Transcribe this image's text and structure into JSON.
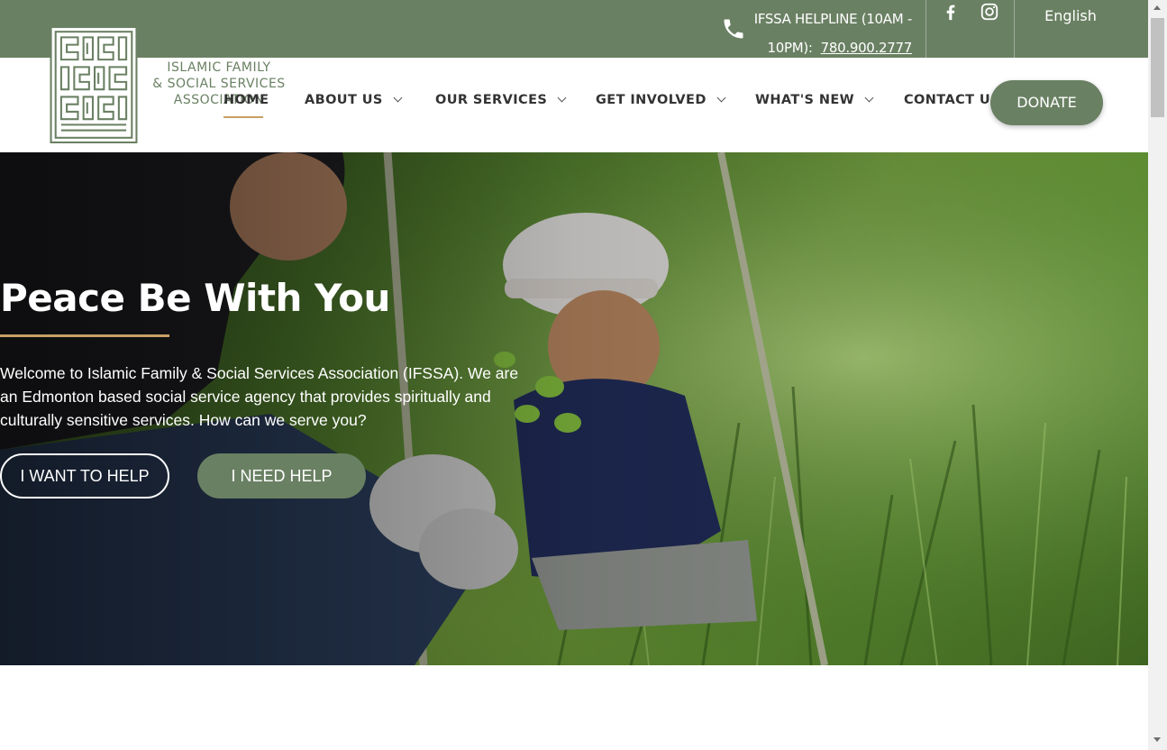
{
  "topbar": {
    "helpline_label": "IFSSA HELPLINE (10AM - 10PM):",
    "helpline_phone": "780.900.2777",
    "language": "English",
    "icons": [
      "phone-icon",
      "facebook-icon",
      "instagram-icon"
    ]
  },
  "logo": {
    "line1": "ISLAMIC FAMILY",
    "line2": "& SOCIAL SERVICES",
    "line3": "ASSOCIATION"
  },
  "nav": {
    "home": "HOME",
    "about": "ABOUT US",
    "services": "OUR SERVICES",
    "involved": "GET INVOLVED",
    "news": "WHAT'S NEW",
    "contact": "CONTACT US"
  },
  "donate_label": "DONATE",
  "hero": {
    "title": "Peace Be With You",
    "text": "Welcome to Islamic Family & Social Services Association (IFSSA). We are an Edmonton based social service agency that provides spiritually and culturally sensitive services. How can we serve you?",
    "want_help": "I WANT TO HELP",
    "need_help": "I NEED HELP"
  },
  "colors": {
    "brand_green": "#6a8063",
    "accent_gold": "#c8a063"
  }
}
